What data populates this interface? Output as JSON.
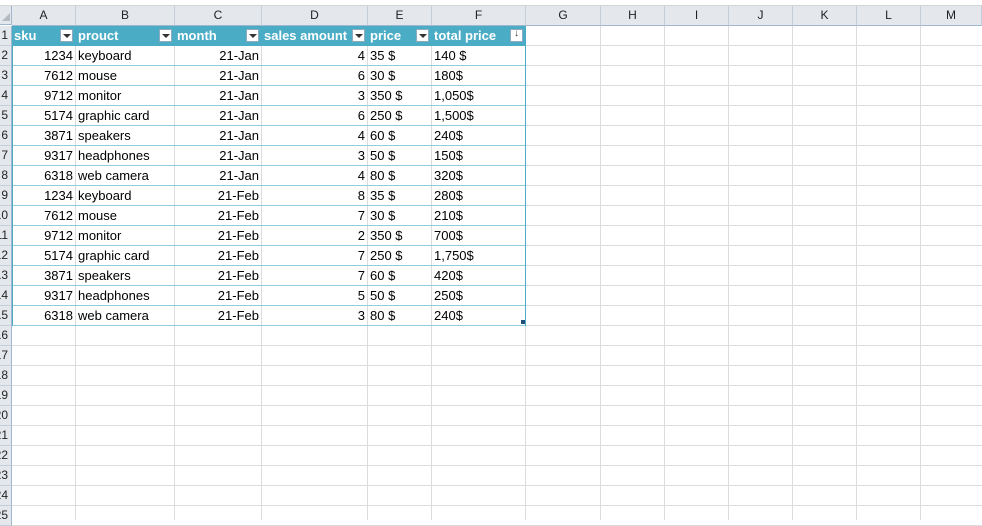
{
  "columns": [
    "A",
    "B",
    "C",
    "D",
    "E",
    "F",
    "G",
    "H",
    "I",
    "J",
    "K",
    "L",
    "M"
  ],
  "row_numbers": [
    "1",
    "2",
    "3",
    "4",
    "5",
    "6",
    "7",
    "8",
    "9",
    "10",
    "11",
    "12",
    "13",
    "14",
    "15",
    "16",
    "17",
    "18",
    "19",
    "20",
    "21",
    "22",
    "23",
    "24",
    "25"
  ],
  "table": {
    "headers": [
      "sku",
      "prouct",
      "month",
      "sales amount",
      "price",
      "total price"
    ],
    "rows": [
      [
        "1234",
        "keyboard",
        "21-Jan",
        "4",
        "35 $",
        "140 $"
      ],
      [
        "7612",
        "mouse",
        "21-Jan",
        "6",
        "30 $",
        "180$"
      ],
      [
        "9712",
        "monitor",
        "21-Jan",
        "3",
        "350 $",
        "1,050$"
      ],
      [
        "5174",
        "graphic card",
        "21-Jan",
        "6",
        "250 $",
        "1,500$"
      ],
      [
        "3871",
        "speakers",
        "21-Jan",
        "4",
        "60 $",
        "240$"
      ],
      [
        "9317",
        "headphones",
        "21-Jan",
        "3",
        "50 $",
        "150$"
      ],
      [
        "6318",
        "web camera",
        "21-Jan",
        "4",
        "80 $",
        "320$"
      ],
      [
        "1234",
        "keyboard",
        "21-Feb",
        "8",
        "35 $",
        "280$"
      ],
      [
        "7612",
        "mouse",
        "21-Feb",
        "7",
        "30 $",
        "210$"
      ],
      [
        "9712",
        "monitor",
        "21-Feb",
        "2",
        "350 $",
        "700$"
      ],
      [
        "5174",
        "graphic card",
        "21-Feb",
        "7",
        "250 $",
        "1,750$"
      ],
      [
        "3871",
        "speakers",
        "21-Feb",
        "7",
        "60 $",
        "420$"
      ],
      [
        "9317",
        "headphones",
        "21-Feb",
        "5",
        "50 $",
        "250$"
      ],
      [
        "6318",
        "web camera",
        "21-Feb",
        "3",
        "80 $",
        "240$"
      ]
    ]
  },
  "colors": {
    "header_fill": "#4bacc6",
    "band_line": "#92cddc"
  }
}
